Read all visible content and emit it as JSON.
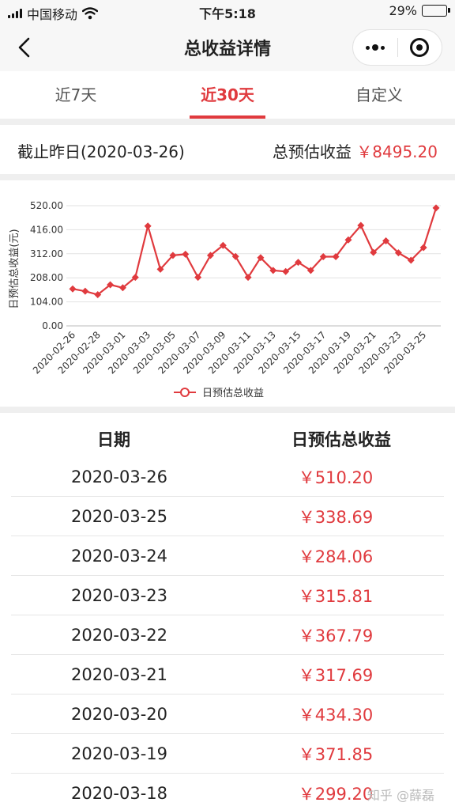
{
  "status": {
    "carrier": "中国移动",
    "time": "下午5:18",
    "battery": "29%",
    "battery_level": 0.29
  },
  "nav": {
    "title": "总收益详情"
  },
  "tabs": [
    {
      "label": "近7天",
      "active": false
    },
    {
      "label": "近30天",
      "active": true
    },
    {
      "label": "自定义",
      "active": false
    }
  ],
  "summary": {
    "date_label": "截止昨日(2020-03-26)",
    "total_label": "总预估收益",
    "total_value": "￥8495.20"
  },
  "chart_data": {
    "type": "line",
    "ylabel": "日预估总收益(元)",
    "legend": "日预估总收益",
    "legend_position": "bottom",
    "color": "#e03a3e",
    "ylim": [
      0,
      520
    ],
    "yticks": [
      "0.00",
      "104.00",
      "208.00",
      "312.00",
      "416.00",
      "520.00"
    ],
    "x": [
      "2020-02-26",
      "2020-02-27",
      "2020-02-28",
      "2020-02-29",
      "2020-03-01",
      "2020-03-02",
      "2020-03-03",
      "2020-03-04",
      "2020-03-05",
      "2020-03-06",
      "2020-03-07",
      "2020-03-08",
      "2020-03-09",
      "2020-03-10",
      "2020-03-11",
      "2020-03-12",
      "2020-03-13",
      "2020-03-14",
      "2020-03-15",
      "2020-03-16",
      "2020-03-17",
      "2020-03-18",
      "2020-03-19",
      "2020-03-20",
      "2020-03-21",
      "2020-03-22",
      "2020-03-23",
      "2020-03-24",
      "2020-03-25",
      "2020-03-26"
    ],
    "xtick_labels": [
      "2020-02-26",
      "2020-02-28",
      "2020-03-01",
      "2020-03-03",
      "2020-03-05",
      "2020-03-07",
      "2020-03-09",
      "2020-03-11",
      "2020-03-13",
      "2020-03-15",
      "2020-03-17",
      "2020-03-19",
      "2020-03-21",
      "2020-03-23",
      "2020-03-25"
    ],
    "series": [
      {
        "name": "日预估总收益",
        "values": [
          160,
          150,
          135,
          178,
          165,
          210,
          432,
          245,
          305,
          310,
          210,
          305,
          348,
          300,
          210,
          295,
          240,
          235,
          275,
          240,
          299.2,
          299.2,
          371.85,
          434.3,
          317.69,
          367.79,
          315.81,
          284.06,
          338.69,
          510.2
        ]
      }
    ]
  },
  "table": {
    "headers": [
      "日期",
      "日预估总收益"
    ],
    "rows": [
      {
        "date": "2020-03-26",
        "value": "￥510.20"
      },
      {
        "date": "2020-03-25",
        "value": "￥338.69"
      },
      {
        "date": "2020-03-24",
        "value": "￥284.06"
      },
      {
        "date": "2020-03-23",
        "value": "￥315.81"
      },
      {
        "date": "2020-03-22",
        "value": "￥367.79"
      },
      {
        "date": "2020-03-21",
        "value": "￥317.69"
      },
      {
        "date": "2020-03-20",
        "value": "￥434.30"
      },
      {
        "date": "2020-03-19",
        "value": "￥371.85"
      },
      {
        "date": "2020-03-18",
        "value": "￥299.20"
      }
    ]
  },
  "watermark": "知乎 @薛磊"
}
